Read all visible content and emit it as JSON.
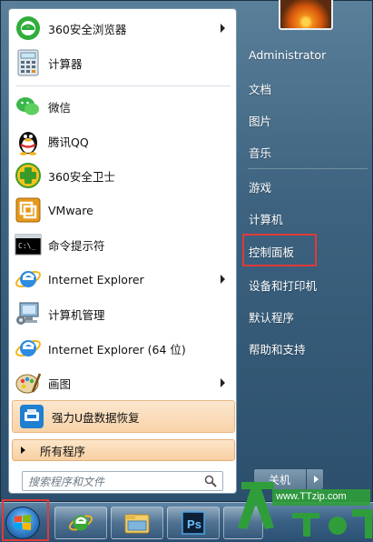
{
  "start_menu": {
    "pinned": [
      {
        "label": "360安全浏览器",
        "icon": "360-browser-icon",
        "has_submenu": true
      },
      {
        "label": "计算器",
        "icon": "calculator-icon",
        "has_submenu": false
      }
    ],
    "recent": [
      {
        "label": "微信",
        "icon": "wechat-icon",
        "has_submenu": false
      },
      {
        "label": "腾讯QQ",
        "icon": "qq-penguin-icon",
        "has_submenu": false
      },
      {
        "label": "360安全卫士",
        "icon": "360-security-icon",
        "has_submenu": false
      },
      {
        "label": "VMware",
        "icon": "vmware-icon",
        "has_submenu": false
      },
      {
        "label": "命令提示符",
        "icon": "cmd-icon",
        "has_submenu": false
      },
      {
        "label": "Internet Explorer",
        "icon": "ie-icon",
        "has_submenu": true
      },
      {
        "label": "计算机管理",
        "icon": "computer-management-icon",
        "has_submenu": false
      },
      {
        "label": "Internet Explorer (64 位)",
        "icon": "ie-icon",
        "has_submenu": false
      },
      {
        "label": "画图",
        "icon": "paint-icon",
        "has_submenu": true
      },
      {
        "label": "强力U盘数据恢复",
        "icon": "usb-recovery-icon",
        "has_submenu": false
      }
    ],
    "all_programs": "所有程序",
    "search_placeholder": "搜索程序和文件",
    "right_items": [
      "Administrator",
      "文档",
      "图片",
      "音乐",
      "游戏",
      "计算机",
      "控制面板",
      "设备和打印机",
      "默认程序",
      "帮助和支持"
    ],
    "highlighted_right_item": "控制面板",
    "shutdown_label": "关机"
  },
  "taskbar": {
    "start_button": "windows-start-orb",
    "pinned": [
      "ie-icon",
      "explorer-folder-icon",
      "photoshop-icon"
    ],
    "photoshop_text": "Ps"
  },
  "watermark": {
    "text": "www.TTzip.com"
  },
  "colors": {
    "highlight_border": "#e03a3a",
    "item_hover": "#f8d3a8",
    "aero_glass": "#3d6380"
  }
}
